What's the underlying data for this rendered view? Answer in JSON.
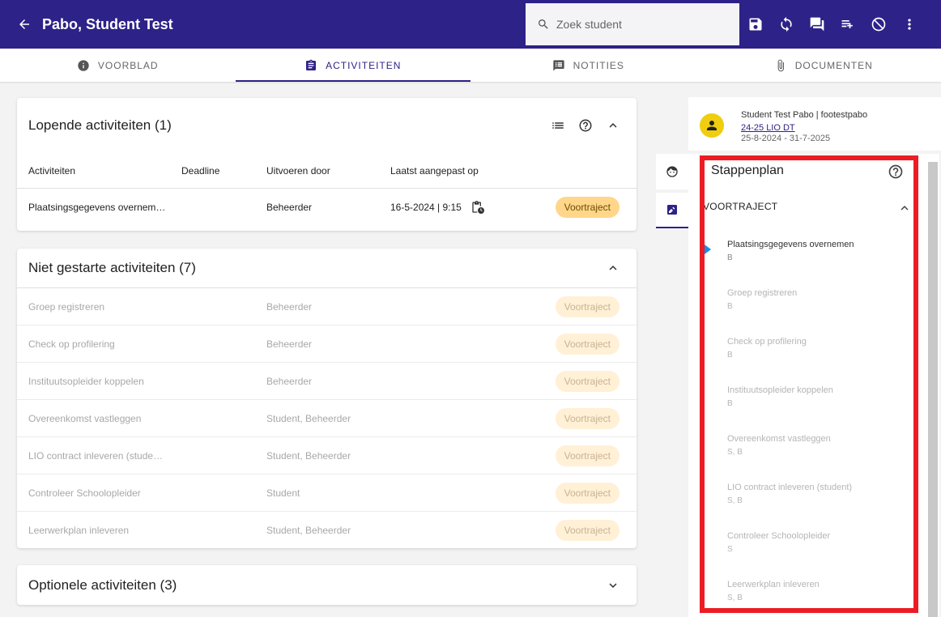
{
  "header": {
    "back_icon": "arrow-left-icon",
    "title": "Pabo, Student Test",
    "search_placeholder": "Zoek student",
    "actions": [
      "save-icon",
      "sync-icon",
      "comment-icon",
      "playlist-add-icon",
      "block-icon",
      "more-vert-icon"
    ]
  },
  "tabs": [
    {
      "label": "VOORBLAD",
      "icon": "info-icon",
      "active": false
    },
    {
      "label": "ACTIVITEITEN",
      "icon": "clipboard-icon",
      "active": true
    },
    {
      "label": "NOTITIES",
      "icon": "notes-icon",
      "active": false
    },
    {
      "label": "DOCUMENTEN",
      "icon": "attachment-icon",
      "active": false
    }
  ],
  "lopende": {
    "title": "Lopende activiteiten (1)",
    "columns": [
      "Activiteiten",
      "Deadline",
      "Uitvoeren door",
      "Laatst aangepast op"
    ],
    "rows": [
      {
        "name": "Plaatsingsgegevens overnem…",
        "deadline": "",
        "door": "Beheerder",
        "aangepast": "16-5-2024 | 9:15",
        "fase": "Voortraject"
      }
    ]
  },
  "niet_gestart": {
    "title": "Niet gestarte activiteiten (7)",
    "rows": [
      {
        "name": "Groep registreren",
        "door": "Beheerder",
        "fase": "Voortraject"
      },
      {
        "name": "Check op profilering",
        "door": "Beheerder",
        "fase": "Voortraject"
      },
      {
        "name": "Instituutsopleider koppelen",
        "door": "Beheerder",
        "fase": "Voortraject"
      },
      {
        "name": "Overeenkomst vastleggen",
        "door": "Student, Beheerder",
        "fase": "Voortraject"
      },
      {
        "name": "LIO contract inleveren (stude…",
        "door": "Student, Beheerder",
        "fase": "Voortraject"
      },
      {
        "name": "Controleer Schoolopleider",
        "door": "Student",
        "fase": "Voortraject"
      },
      {
        "name": "Leerwerkplan inleveren",
        "door": "Student, Beheerder",
        "fase": "Voortraject"
      }
    ]
  },
  "optioneel": {
    "title": "Optionele activiteiten (3)"
  },
  "student": {
    "name": "Student Test Pabo | footestpabo",
    "link": "24-25 LIO DT",
    "dates": "25-8-2024 - 31-7-2025"
  },
  "stappenplan": {
    "title": "Stappenplan",
    "phase": "VOORTRAJECT",
    "steps": [
      {
        "name": "Plaatsingsgegevens overnemen",
        "roles": "B",
        "current": true
      },
      {
        "name": "Groep registreren",
        "roles": "B",
        "current": false
      },
      {
        "name": "Check op profilering",
        "roles": "B",
        "current": false
      },
      {
        "name": "Instituutsopleider koppelen",
        "roles": "B",
        "current": false
      },
      {
        "name": "Overeenkomst vastleggen",
        "roles": "S, B",
        "current": false
      },
      {
        "name": "LIO contract inleveren (student)",
        "roles": "S, B",
        "current": false
      },
      {
        "name": "Controleer Schoolopleider",
        "roles": "S",
        "current": false
      },
      {
        "name": "Leerwerkplan inleveren",
        "roles": "S, B",
        "current": false
      }
    ]
  },
  "colors": {
    "primary": "#2d2288",
    "badge": "#ffd68a",
    "highlight": "#ec1c24",
    "avatar": "#efcd10",
    "step_marker": "#1e8ce0"
  }
}
